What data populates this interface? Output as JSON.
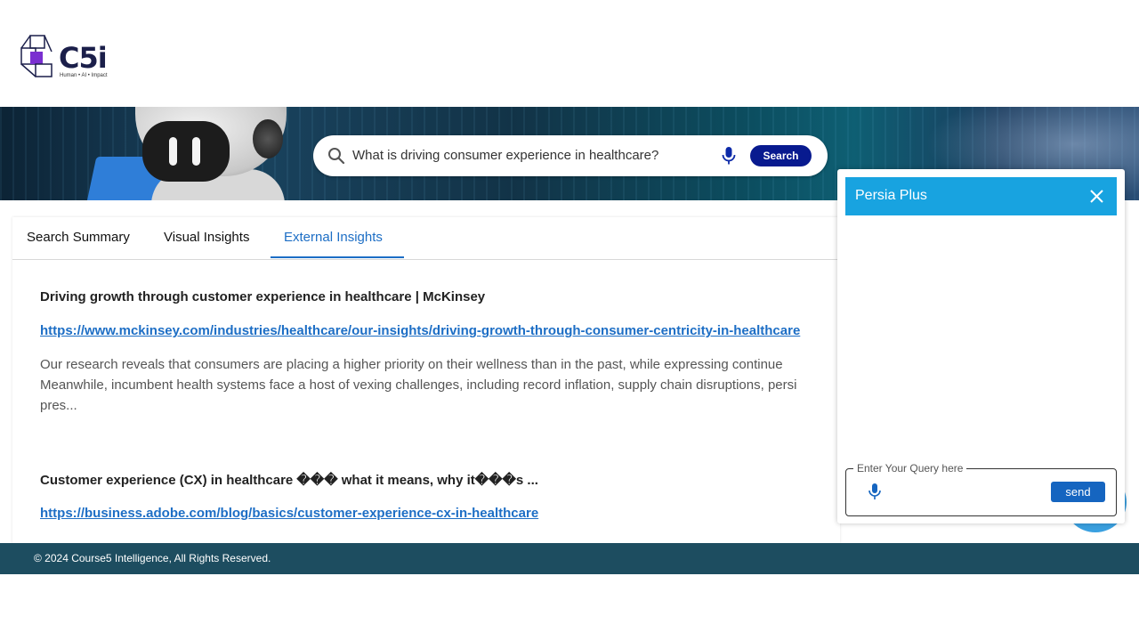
{
  "brand": {
    "logo_text": "C5i",
    "tagline": "Human • AI • Impact",
    "icon": "c5i-logo-icon"
  },
  "search": {
    "query": "What is driving consumer experience in healthcare?",
    "button_label": "Search",
    "search_icon": "search-icon",
    "mic_icon": "mic-icon",
    "button_color": "#081a8f"
  },
  "tabs": [
    {
      "label": "Search Summary",
      "active": false
    },
    {
      "label": "Visual Insights",
      "active": false
    },
    {
      "label": "External Insights",
      "active": true
    }
  ],
  "results": [
    {
      "title": "Driving growth through customer experience in healthcare | McKinsey",
      "url": "https://www.mckinsey.com/industries/healthcare/our-insights/driving-growth-through-consumer-centricity-in-healthcare",
      "description_lines": [
        "Our research reveals that consumers are placing a higher priority on their wellness than in the past, while expressing continue",
        "Meanwhile, incumbent health systems face a host of vexing challenges, including record inflation, supply chain disruptions, persi",
        "pres..."
      ]
    },
    {
      "title": "Customer experience (CX) in healthcare ��� what it means, why it���s ...",
      "url": "https://business.adobe.com/blog/basics/customer-experience-cx-in-healthcare",
      "description_lines": []
    }
  ],
  "chat": {
    "title": "Persia Plus",
    "close_icon": "close-icon",
    "input_label": "Enter Your Query here",
    "input_value": "",
    "mic_icon": "mic-icon",
    "send_label": "send",
    "header_color": "#18a3e0"
  },
  "footer": {
    "text": "© 2024 Course5 Intelligence, All Rights Reserved."
  },
  "colors": {
    "accent": "#1d6ec5",
    "footer_bg": "#1d4d60"
  }
}
